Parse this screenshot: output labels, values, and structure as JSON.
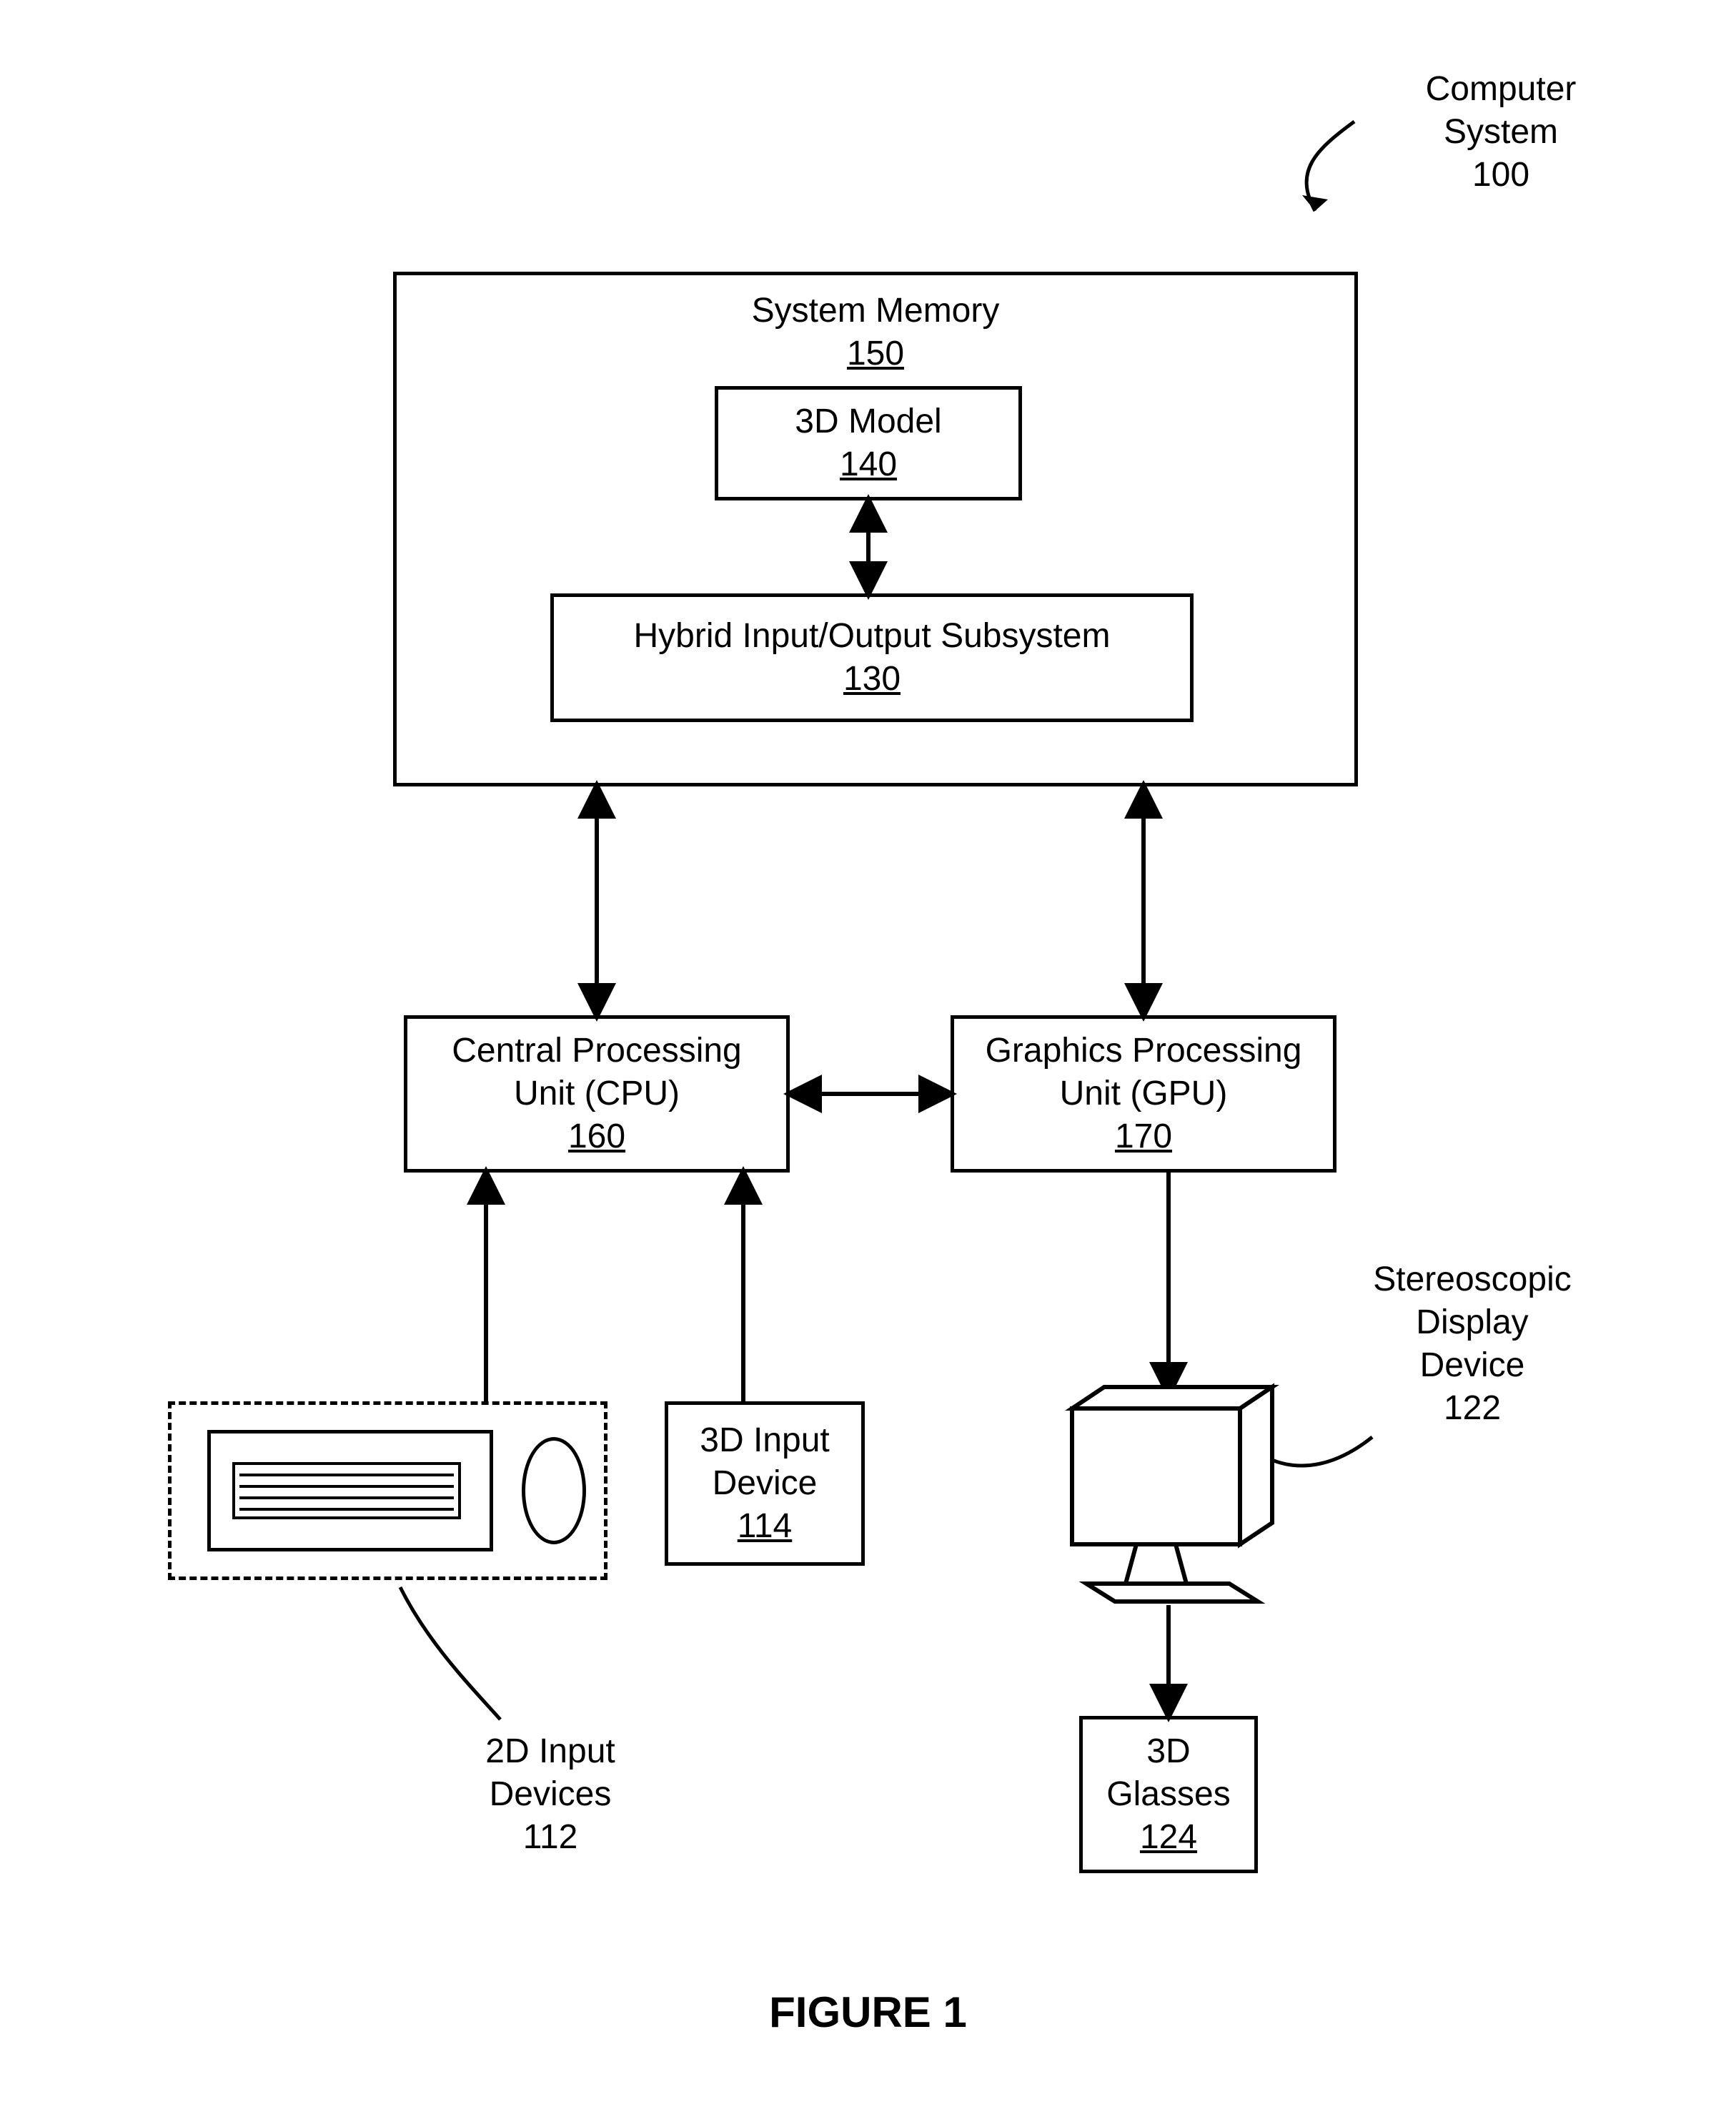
{
  "title": {
    "label_l1": "Computer",
    "label_l2": "System",
    "num": "100"
  },
  "figure_caption": "FIGURE 1",
  "memory": {
    "title": "System Memory",
    "num": "150",
    "model": {
      "title": "3D Model",
      "num": "140"
    },
    "hybrid": {
      "title": "Hybrid Input/Output Subsystem",
      "num": "130"
    }
  },
  "cpu": {
    "title_l1": "Central Processing",
    "title_l2": "Unit (CPU)",
    "num": "160"
  },
  "gpu": {
    "title_l1": "Graphics Processing",
    "title_l2": "Unit (GPU)",
    "num": "170"
  },
  "input3d": {
    "title_l1": "3D Input",
    "title_l2": "Device",
    "num": "114"
  },
  "input2d_label": {
    "l1": "2D Input",
    "l2": "Devices",
    "num": "112"
  },
  "display_label": {
    "l1": "Stereoscopic",
    "l2": "Display",
    "l3": "Device",
    "num": "122"
  },
  "glasses": {
    "title_l1": "3D",
    "title_l2": "Glasses",
    "num": "124"
  }
}
